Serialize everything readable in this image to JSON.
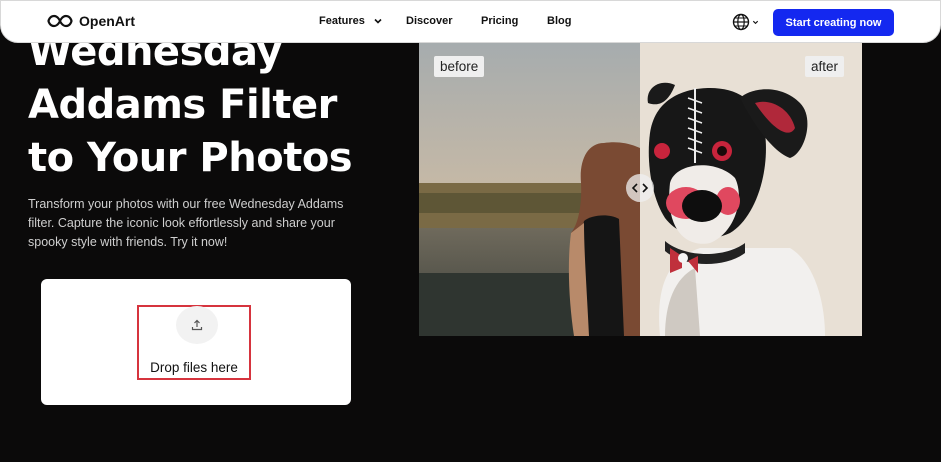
{
  "nav": {
    "logo_text": "OpenArt",
    "links": [
      "Features",
      "Discover",
      "Pricing",
      "Blog"
    ],
    "cta": "Start creating now"
  },
  "hero": {
    "title_lines": [
      "Wednesday",
      "Addams Filter",
      "to Your Photos"
    ],
    "description": "Transform your photos with our free Wednesday Addams filter. Capture the iconic look effortlessly and share your spooky style with friends. Try it now!"
  },
  "upload": {
    "label": "Drop files here"
  },
  "compare": {
    "before_label": "before",
    "after_label": "after"
  },
  "colors": {
    "accent": "#1428f0",
    "background": "#0b0a0a",
    "highlight_border": "#d6343e"
  },
  "icons": [
    "openart-logo-icon",
    "chevron-down-icon",
    "globe-icon",
    "upload-icon",
    "compare-arrows-icon"
  ]
}
